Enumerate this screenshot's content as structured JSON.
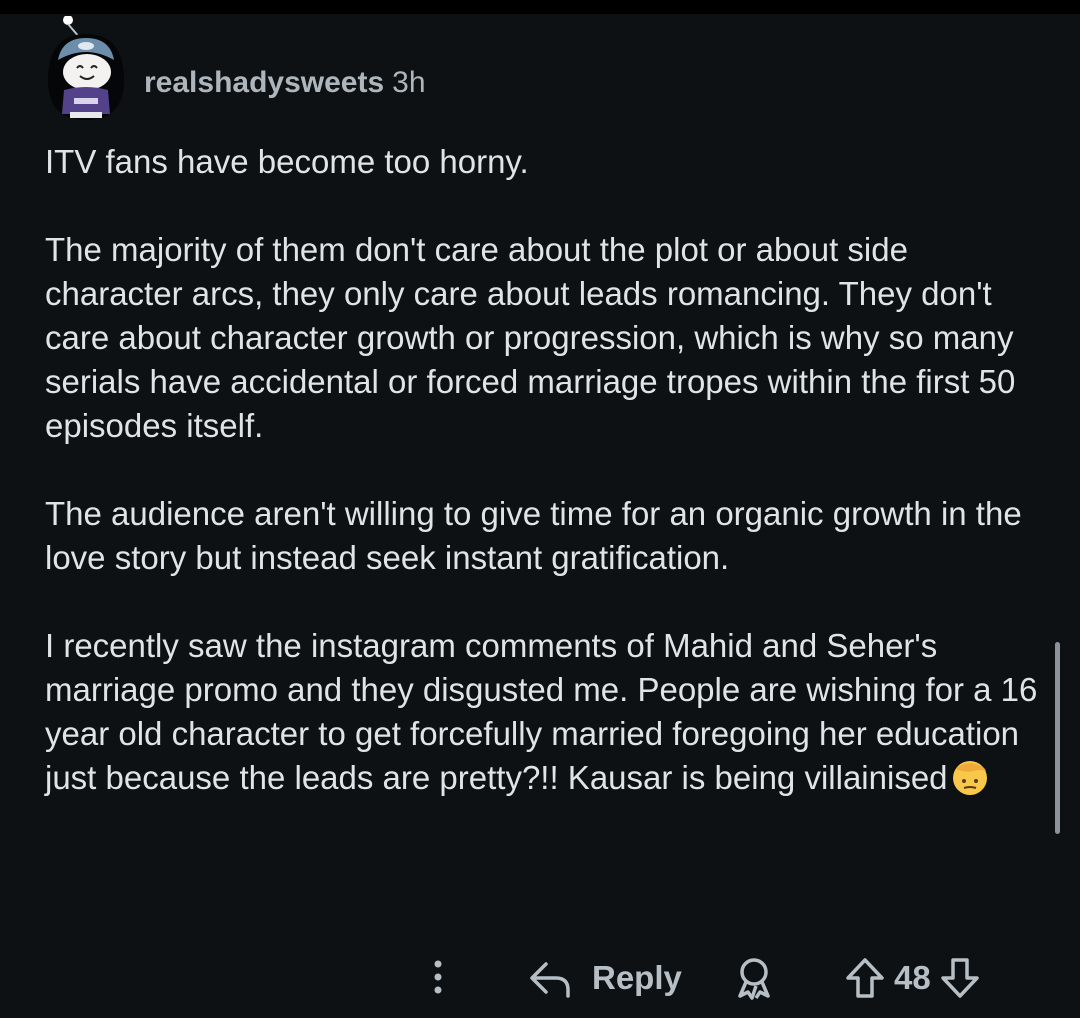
{
  "comment": {
    "username": "realshadysweets",
    "timestamp": "3h",
    "paragraphs": [
      "ITV fans have become too horny.",
      "The majority of them don't care about the plot or about side character arcs, they only care about leads romancing. They don't care about character growth or progression, which is why so many serials have accidental or forced marriage tropes within the first 50 episodes itself.",
      "The audience aren't willing to give time for an organic growth in the love story but instead seek instant gratification.",
      "I recently saw the instagram comments of Mahid and Seher's marriage promo and they disgusted me. People are wishing for a 16 year old character to get forcefully married foregoing her education just because the leads are pretty?!! Kausar is being villainised"
    ],
    "trailing_emoji": "face-with-hand-over-forehead"
  },
  "actions": {
    "more_icon": "more-vertical-icon",
    "reply_label": "Reply",
    "award_icon": "award-icon",
    "upvote_icon": "upvote-arrow-icon",
    "vote_count": "48",
    "downvote_icon": "downvote-arrow-icon"
  },
  "colors": {
    "background": "#0e1113",
    "text": "#dfe4e8",
    "muted": "#aeb6bd"
  }
}
